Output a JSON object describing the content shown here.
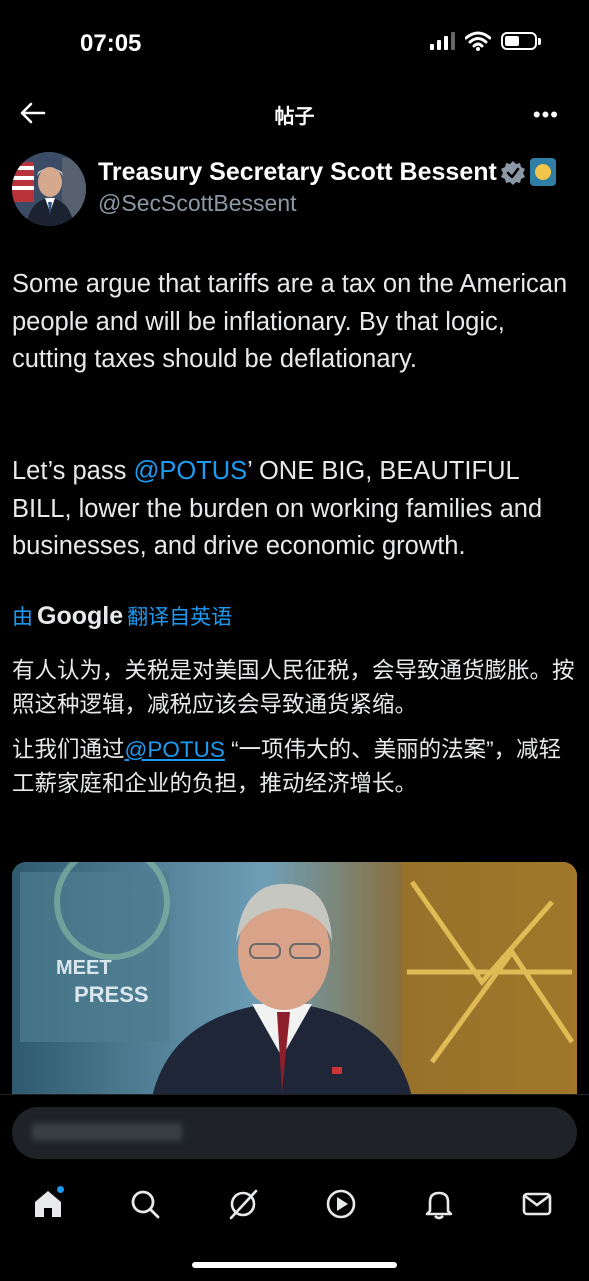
{
  "status_bar": {
    "time": "07:05"
  },
  "header": {
    "title": "帖子"
  },
  "post": {
    "author_name": "Treasury Secretary Scott Bessent",
    "author_handle": "@SecScottBessent",
    "paragraph1": "Some argue that tariffs are a tax on the American people and will be inflationary. By that logic, cutting taxes should be deflationary.",
    "paragraph2_before": "Let’s pass ",
    "paragraph2_mention": "@POTUS",
    "paragraph2_after": "’ ONE BIG, BEAUTIFUL BILL, lower the burden on working families and businesses, and drive economic growth.",
    "translation": {
      "by_label": "由",
      "provider": "Google",
      "label": "翻译自英语",
      "paragraph1": "有人认为，关税是对美国人民征税，会导致通货膨胀。按照这种逻辑，减税应该会导致通货紧缩。",
      "paragraph2_before": "让我们通过",
      "paragraph2_mention": "@POTUS",
      "paragraph2_after": " “一项伟大的、美丽的法案”，减轻工薪家庭和企业的负担，推动经济增长。"
    },
    "media": {
      "overlay_text": "MEET THE PRESS"
    }
  },
  "nav": {
    "items": [
      "home-icon",
      "search-icon",
      "grok-icon",
      "video-icon",
      "notifications-icon",
      "messages-icon"
    ]
  },
  "colors": {
    "accent": "#1d9bf0",
    "background": "#000000",
    "text": "#e7e9ea",
    "muted": "#8b98a5"
  }
}
